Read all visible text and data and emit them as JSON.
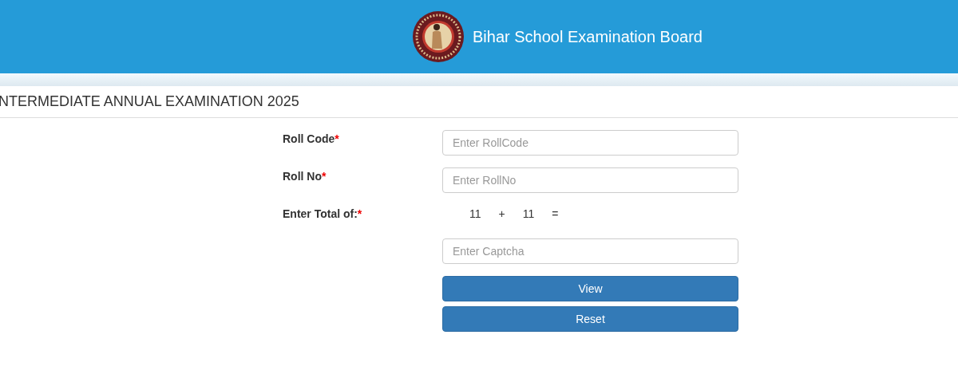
{
  "header": {
    "title": "Bihar School Examination Board"
  },
  "page_title": "NTERMEDIATE ANNUAL EXAMINATION 2025",
  "form": {
    "fields": [
      {
        "label": "Roll Code",
        "required_mark": "*",
        "placeholder": "Enter RollCode"
      },
      {
        "label": "Roll No",
        "required_mark": "*",
        "placeholder": "Enter RollNo"
      }
    ],
    "captcha": {
      "label": "Enter Total of:",
      "required_mark": "*",
      "operand_1": "11",
      "operator": "+",
      "operand_2": "11",
      "equals": "=",
      "placeholder": "Enter Captcha"
    },
    "buttons": [
      "View",
      "Reset"
    ]
  }
}
